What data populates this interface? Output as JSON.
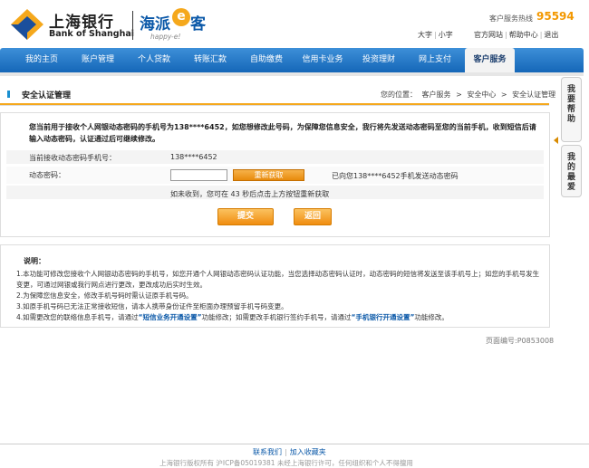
{
  "header": {
    "bank_name_cn": "上海银行",
    "bank_name_en": "Bank of Shanghai",
    "sub_brand_cn_1": "海派",
    "sub_brand_e": "e",
    "sub_brand_cn_2": "客",
    "sub_brand_en": "happy-e!",
    "hotline_label": "客户服务热线",
    "hotline_number": "95594",
    "font_large": "大字",
    "font_small": "小字",
    "official_site": "官方网站",
    "help_center": "帮助中心",
    "logout": "退出",
    "colors": {
      "brand_orange": "#f39800",
      "brand_blue": "#0a58a8"
    }
  },
  "nav": {
    "items": [
      {
        "label": "我的主页"
      },
      {
        "label": "账户管理"
      },
      {
        "label": "个人贷款"
      },
      {
        "label": "转账汇款"
      },
      {
        "label": "自助缴费"
      },
      {
        "label": "信用卡业务"
      },
      {
        "label": "投资理财"
      },
      {
        "label": "网上支付"
      },
      {
        "label": "客户服务",
        "active": true
      }
    ]
  },
  "sidebar": {
    "help_tab": "我要帮助",
    "favorites_tab": "我的最爱"
  },
  "section": {
    "title": "安全认证管理",
    "breadcrumb_label": "您的位置：",
    "breadcrumb_1": "客户服务",
    "breadcrumb_2": "安全中心",
    "breadcrumb_3": "安全认证管理",
    "breadcrumb_sep": ">"
  },
  "form": {
    "notice": "您当前用于接收个人网银动态密码的手机号为138****6452，如您想修改此号码，为保障您信息安全，我行将先发送动态密码至您的当前手机，收到短信后请输入动态密码，认证通过后可继续修改。",
    "phone_label": "当前接收动态密码手机号：",
    "phone_value": "138****6452",
    "code_label": "动态密码：",
    "code_value": "",
    "resend_button": "重新获取",
    "sent_message": "已向您138****6452手机发送动态密码",
    "countdown_text": "如未收到，您可在  43 秒后点击上方按钮重新获取",
    "submit_button": "提交",
    "back_button": "返回"
  },
  "notes": {
    "title": "说明：",
    "items": [
      {
        "num": "1.",
        "text": "本功能可修改您接收个人网银动态密码的手机号，如您开通个人网银动态密码认证功能，当您选择动态密码认证时，动态密码的短信将发送至该手机号上；如您的手机号发生变更，可通过网银或我行网点进行更改，更改成功后实时生效。"
      },
      {
        "num": "2.",
        "text": "为保障您信息安全，修改手机号码时需认证原手机号码。"
      },
      {
        "num": "3.",
        "text": "如原手机号码已无法正常接收短信，请本人携带身份证件至柜面办理预留手机号码变更。"
      },
      {
        "num": "4.",
        "text_before": "如需更改您的联络信息手机号，请通过",
        "link_1": "“短信业务开通设置”",
        "text_middle": "功能修改；如需更改手机银行签约手机号，请通过",
        "link_2": "“手机银行开通设置”",
        "text_after": "功能修改。"
      }
    ]
  },
  "page_id": "页面编号:P0853008",
  "footer": {
    "contact": "联系我们",
    "bookmark": "加入收藏夹",
    "copyright": "上海银行版权所有 沪ICP备05019381 未经上海银行许可，任何组织和个人不得擅用"
  }
}
